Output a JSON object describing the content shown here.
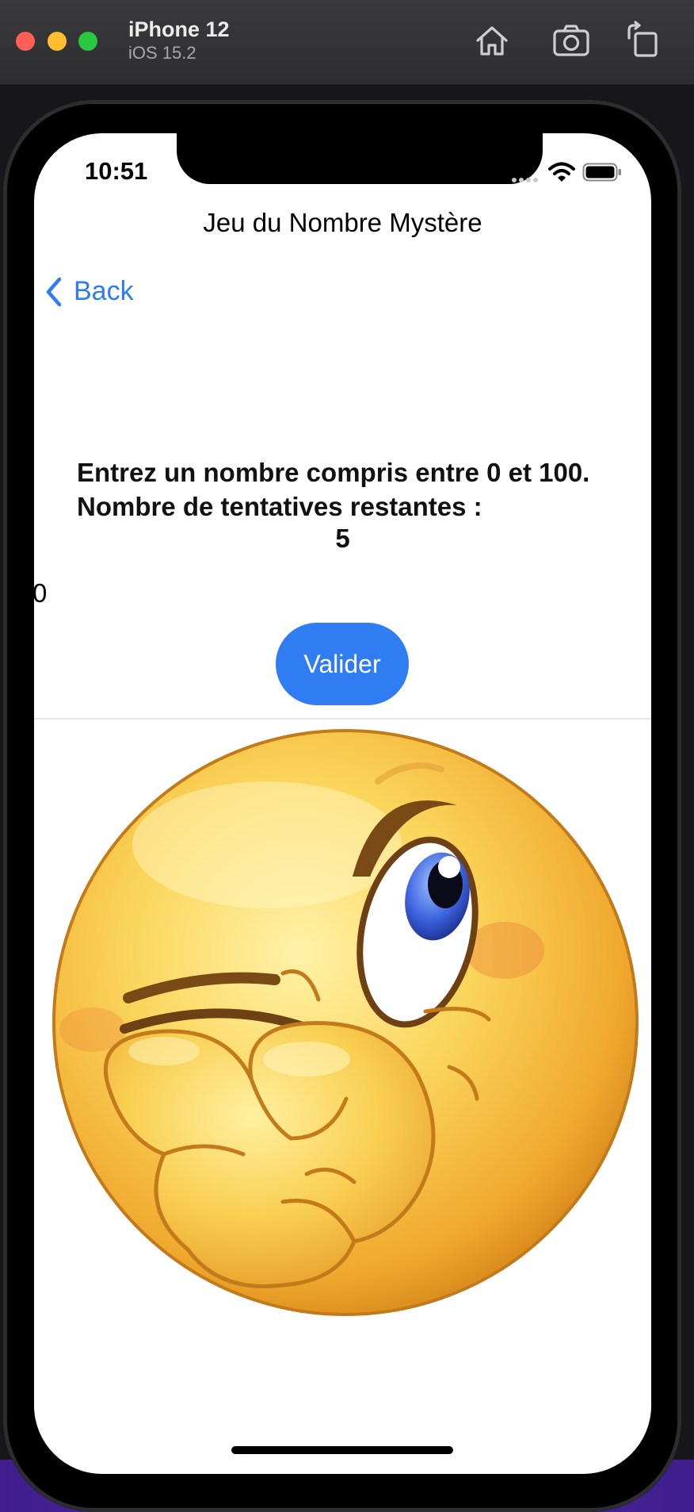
{
  "window": {
    "device_name": "iPhone 12",
    "os_version": "iOS 15.2"
  },
  "toolbar": {
    "icons": [
      "home-icon",
      "camera-icon",
      "rotate-icon"
    ]
  },
  "status_bar": {
    "time": "10:51"
  },
  "nav": {
    "title": "Jeu du Nombre Mystère",
    "back_label": "Back"
  },
  "game": {
    "prompt": "Entrez un nombre compris entre 0 et 100.\nNombre de tentatives restantes :",
    "attempts_remaining": "5",
    "input_value": "0",
    "validate_label": "Valider"
  },
  "colors": {
    "accent": "#2f7cf3",
    "back_link": "#2d7cf0"
  }
}
